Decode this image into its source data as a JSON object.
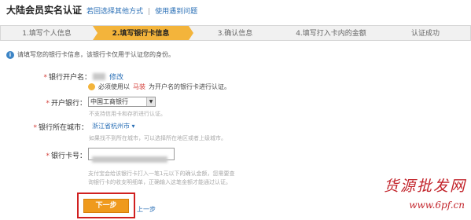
{
  "header": {
    "title": "大陆会员实名认证",
    "link_switch": "若回选择其他方式",
    "separator": "|",
    "link_help": "使用遇到问题"
  },
  "steps": [
    {
      "label": "1.填写个人信息",
      "active": false
    },
    {
      "label": "2.填写银行卡信息",
      "active": true
    },
    {
      "label": "3.确认信息",
      "active": false
    },
    {
      "label": "4.填写打入卡内的金额",
      "active": false
    },
    {
      "label": "认证成功",
      "active": false
    }
  ],
  "hint": {
    "icon": "info-icon",
    "text": "请填写您的银行卡信息，该银行卡仅用于认证您的身份。"
  },
  "form": {
    "account_name_label": "银行开户名：",
    "modify_link": "修改",
    "warning_prefix": "必须使用以",
    "warning_highlight": "马装",
    "warning_suffix": "为开户名的银行卡进行认证。",
    "bank_label": "开户银行：",
    "bank_value": "中国工商银行",
    "bank_note": "不支持信用卡和存折进行认证。",
    "city_label": "银行所在城市：",
    "city_value": "浙江省杭州市 ▾",
    "city_note": "如果找不到所在城市，可以选择所在地区或者上级城市。",
    "card_label": "银行卡号：",
    "card_note": "支付宝会给该银行卡打入一笔1元以下的确认金额，您需要查询银行卡的收支明细单，正确输入这笔金额才能通过认证。"
  },
  "actions": {
    "next_label": "下一步",
    "prev_label": "上一步"
  },
  "watermark": {
    "text": "货源批发网",
    "url": "www.6pf.cn"
  },
  "colors": {
    "active_step": "#f3b43b",
    "next_button": "#ef9a1d",
    "highlight_box": "#d02020",
    "link": "#2a6fb6"
  }
}
